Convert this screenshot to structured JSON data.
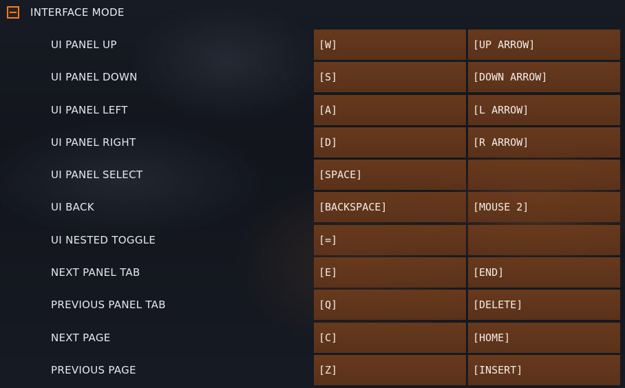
{
  "section": {
    "title": "INTERFACE MODE",
    "toggle_icon": "minus-icon",
    "accent_color": "#ff7a1a"
  },
  "bindings": [
    {
      "action": "UI PANEL UP",
      "primary": "[W]",
      "secondary": "[UP ARROW]"
    },
    {
      "action": "UI PANEL DOWN",
      "primary": "[S]",
      "secondary": "[DOWN ARROW]"
    },
    {
      "action": "UI PANEL LEFT",
      "primary": "[A]",
      "secondary": "[L ARROW]"
    },
    {
      "action": "UI PANEL RIGHT",
      "primary": "[D]",
      "secondary": "[R ARROW]"
    },
    {
      "action": "UI PANEL SELECT",
      "primary": "[SPACE]",
      "secondary": ""
    },
    {
      "action": "UI BACK",
      "primary": "[BACKSPACE]",
      "secondary": "[MOUSE 2]"
    },
    {
      "action": "UI NESTED TOGGLE",
      "primary": "[=]",
      "secondary": ""
    },
    {
      "action": "NEXT PANEL TAB",
      "primary": "[E]",
      "secondary": "[END]"
    },
    {
      "action": "PREVIOUS PANEL TAB",
      "primary": "[Q]",
      "secondary": "[DELETE]"
    },
    {
      "action": "NEXT PAGE",
      "primary": "[C]",
      "secondary": "[HOME]"
    },
    {
      "action": "PREVIOUS PAGE",
      "primary": "[Z]",
      "secondary": "[INSERT]"
    }
  ]
}
